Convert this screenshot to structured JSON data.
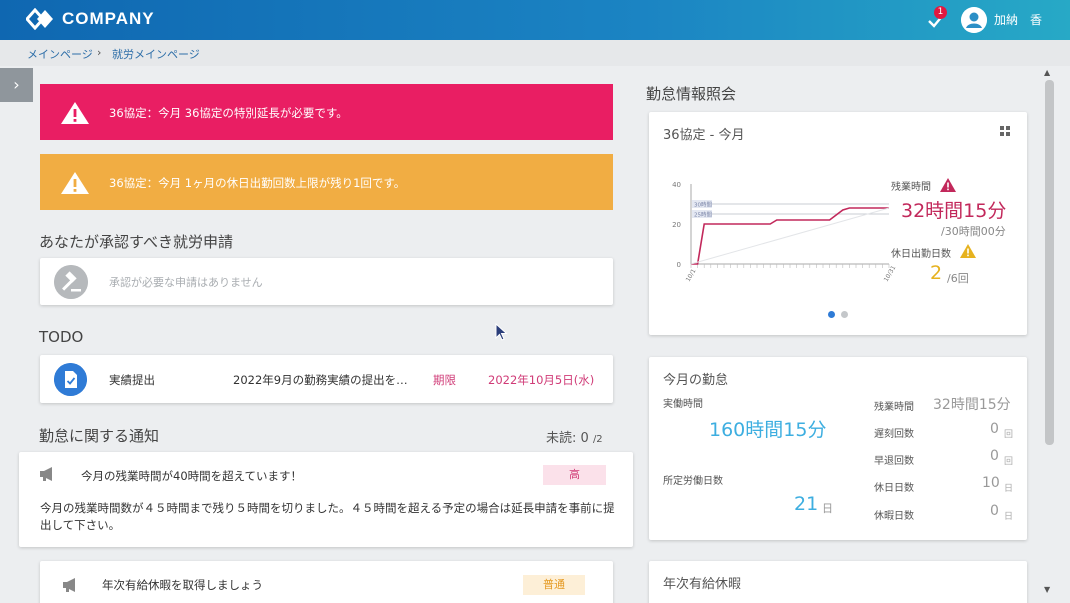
{
  "header": {
    "logo_text": "COMPANY",
    "notification_count": "1",
    "user_name": "加納　香"
  },
  "breadcrumb": {
    "items": [
      "メインページ",
      "›",
      "就労メインページ"
    ]
  },
  "alerts": [
    {
      "text": "36協定：今月 36協定の特別延長が必要です。",
      "color": "#e91e63"
    },
    {
      "text": "36協定：今月 1ヶ月の休日出勤回数上限が残り1回です。",
      "color": "#f1ad43"
    }
  ],
  "approval": {
    "title": "あなたが承認すべき就労申請",
    "empty_text": "承認が必要な申請はありません"
  },
  "todo": {
    "title": "TODO",
    "items": [
      {
        "label": "実績提出",
        "description": "2022年9月の勤務実績の提出を…",
        "deadline_label": "期限",
        "deadline": "2022年10月5日(水)"
      }
    ]
  },
  "notices": {
    "title": "勤怠に関する通知",
    "unread_label": "未読: 0",
    "unread_total": "/2",
    "items": [
      {
        "title": "今月の残業時間が40時間を超えています！",
        "priority": "高",
        "body": "今月の残業時間数が４５時間まで残り５時間を切りました。４５時間を超える予定の場合は延長申請を事前に提出して下さい。"
      },
      {
        "title": "年次有給休暇を取得しましょう",
        "priority": "普通"
      }
    ]
  },
  "attendance_info": {
    "title": "勤怠情報照会",
    "agreement_card": {
      "title": "36協定 - 今月",
      "overtime_label": "残業時間",
      "overtime_value": "32時間15分",
      "overtime_limit": "/30時間00分",
      "holiday_label": "休日出勤日数",
      "holiday_value": "2",
      "holiday_limit": "/6回"
    },
    "month_card": {
      "title": "今月の勤怠",
      "actual_work_label": "実働時間",
      "actual_work_value": "160時間15分",
      "scheduled_days_label": "所定労働日数",
      "scheduled_days_value": "21",
      "scheduled_days_unit": "日",
      "stats": [
        {
          "label": "残業時間",
          "value": "32時間15分",
          "unit": ""
        },
        {
          "label": "遅刻回数",
          "value": "0",
          "unit": "回"
        },
        {
          "label": "早退回数",
          "value": "0",
          "unit": "回"
        },
        {
          "label": "休日日数",
          "value": "10",
          "unit": "日"
        },
        {
          "label": "休暇日数",
          "value": "0",
          "unit": "日"
        }
      ]
    },
    "leave_card": {
      "title": "年次有給休暇"
    }
  },
  "chart_data": {
    "type": "line",
    "x_tick_labels": [
      "10/1",
      "10/31"
    ],
    "y_tick_labels": [
      "0",
      "20",
      "40"
    ],
    "ylim": [
      0,
      40
    ],
    "reference_lines": [
      {
        "name": "30時間",
        "value": 30
      },
      {
        "name": "25時間",
        "value": 25
      }
    ],
    "series": [
      {
        "values": [
          [
            1,
            0
          ],
          [
            2,
            0
          ],
          [
            3,
            20
          ],
          [
            13,
            20
          ],
          [
            14,
            22
          ],
          [
            22,
            22
          ],
          [
            24,
            27
          ],
          [
            25,
            28
          ],
          [
            31,
            28
          ]
        ]
      },
      {
        "values": [
          [
            8,
            30
          ],
          [
            31,
            30
          ]
        ]
      },
      {
        "values": [
          [
            1,
            0
          ],
          [
            31,
            28
          ]
        ]
      }
    ],
    "colors": {
      "actual": "#c2285b",
      "reference": "#c9cdd3",
      "projection": "#e3e5e8"
    }
  }
}
